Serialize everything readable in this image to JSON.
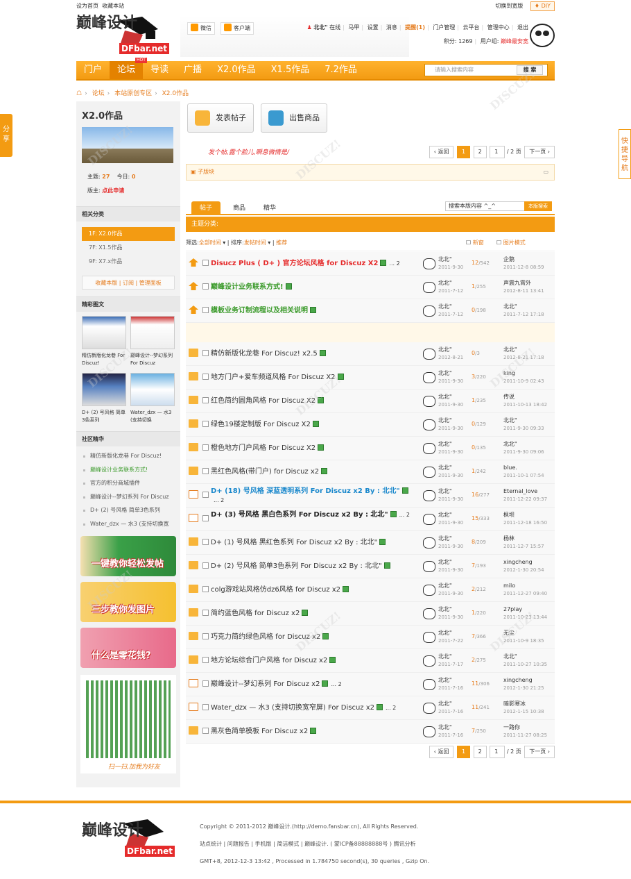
{
  "topbar": {
    "set_home": "设为首页",
    "favorite": "收藏本站",
    "switch_width": "切换到宽版",
    "diy": "♦ DIY"
  },
  "header": {
    "logo_text": "巅峰设计",
    "logo_badge": "DFbar.net",
    "weixin": "微信",
    "client": "客户端",
    "user": "北北\"",
    "online": "在线",
    "menu": [
      "马甲",
      "设置",
      "消息",
      "提醒(1)",
      "门户管理",
      "云平台",
      "管理中心",
      "退出"
    ],
    "points": "积分: 1269",
    "group": "用户组:",
    "group_name": "巅峰最安宽"
  },
  "nav": {
    "items": [
      "门户",
      "论坛",
      "导读",
      "广播",
      "X2.0作品",
      "X1.5作品",
      "7.2作品"
    ],
    "hot": "HOT",
    "search_placeholder": "请输入搜索内容",
    "search_btn": "搜 索"
  },
  "crumb": [
    "论坛",
    "本站原创专区",
    "X2.0作品"
  ],
  "side": {
    "forum_title": "X2.0作品",
    "topics_label": "主题:",
    "topics": "27",
    "today_label": "今日:",
    "today": "0",
    "mod_label": "版主:",
    "mod": "点此申请",
    "related_h": "相关分类",
    "cats": [
      "1F: X2.0作品",
      "7F: X1.5作品",
      "9F: X7.x作品"
    ],
    "links": "收藏本版 | 订阅 | 管理面板",
    "photos_h": "精彩图文",
    "thumbs": [
      "精仿新版化龙巷 For Discuz!",
      "巅峰设计--梦幻系列 For Discuz",
      "D+ (2) 号风格 简单3色系列",
      "Water_dzx — 水3 (支持切换"
    ],
    "community_h": "社区精华",
    "community": [
      "精仿新版化龙巷 For Discuz!",
      "巅峰设计业务联系方式!",
      "官方的积分商城插件",
      "巅峰设计--梦幻系列 For Discuz",
      "D+ (2) 号风格 简单3色系列",
      "Water_dzx — 水3 (支持切换宽"
    ],
    "banners": [
      "一键教你轻松发帖",
      "三步教你发图片",
      "什么是零花钱?"
    ],
    "qr_caption": "扫一扫,加我为好友"
  },
  "main": {
    "post_btn": "发表帖子",
    "sell_btn": "出售商品",
    "slogan": "发个帖,露个脸儿,瞬息微情是/",
    "pager": {
      "back": "返回",
      "pages": [
        "1",
        "2"
      ],
      "jump": "1",
      "total": "/ 2 页",
      "next": "下一页"
    },
    "subforum": "子版块",
    "tabs": [
      "帖子",
      "商品",
      "精华"
    ],
    "tab_search": "搜索本版内容 ^_^",
    "tab_search_btn": "本版搜索",
    "type_bar": "主题分类:",
    "filter": {
      "label": "筛选:",
      "time": "全部时间",
      "sort_label": "排序:",
      "sort": "发帖时间",
      "rec": "推荐",
      "new": "新窗",
      "pic": "图片模式"
    },
    "threads": [
      {
        "title": "Disucz Plus ( D+ ) 官方论坛风格 for Discuz X2",
        "style": "red",
        "icon": "up",
        "extra": "... 2",
        "author": "北北\"",
        "date": "2011-9-30",
        "replies": "12",
        "views": "542",
        "last": "企鹅",
        "last_date": "2011-12-8 08:59"
      },
      {
        "title": "巅峰设计业务联系方式!",
        "style": "green",
        "icon": "up",
        "extra": "",
        "author": "北北\"",
        "date": "2011-7-12",
        "replies": "1",
        "views": "255",
        "last": "声震九霄外",
        "last_date": "2012-8-11 13:41"
      },
      {
        "title": "模板业务订制流程以及相关说明",
        "style": "green",
        "icon": "up",
        "extra": "",
        "author": "北北\"",
        "date": "2011-7-12",
        "replies": "0",
        "views": "198",
        "last": "北北\"",
        "last_date": "2011-7-12 17:18"
      },
      {
        "title": "精仿新版化龙巷 For Discuz! x2.5",
        "style": "",
        "icon": "folder",
        "extra": "",
        "author": "北北\"",
        "date": "2012-8-21",
        "replies": "0",
        "views": "3",
        "last": "北北\"",
        "last_date": "2012-8-21 17:18"
      },
      {
        "title": "地方门户+爱车频道风格 For Discuz X2",
        "style": "",
        "icon": "folder",
        "extra": "",
        "author": "北北\"",
        "date": "2011-9-30",
        "replies": "3",
        "views": "220",
        "last": "king",
        "last_date": "2011-10-9 02:43"
      },
      {
        "title": "红色简约圆角风格 For Discuz X2",
        "style": "",
        "icon": "folder",
        "extra": "",
        "author": "北北\"",
        "date": "2011-9-30",
        "replies": "1",
        "views": "235",
        "last": "传说",
        "last_date": "2011-10-13 18:42"
      },
      {
        "title": "绿色19楼定制版 For Discuz X2",
        "style": "",
        "icon": "folder",
        "extra": "",
        "author": "北北\"",
        "date": "2011-9-30",
        "replies": "0",
        "views": "129",
        "last": "北北\"",
        "last_date": "2011-9-30 09:33"
      },
      {
        "title": "橙色地方门户风格 For Discuz X2",
        "style": "",
        "icon": "folder",
        "extra": "",
        "author": "北北\"",
        "date": "2011-9-30",
        "replies": "0",
        "views": "135",
        "last": "北北\"",
        "last_date": "2011-9-30 09:06"
      },
      {
        "title": "黑红色风格(带门户) for Discuz x2",
        "style": "",
        "icon": "folder",
        "extra": "",
        "author": "北北\"",
        "date": "2011-9-30",
        "replies": "1",
        "views": "242",
        "last": "blue.",
        "last_date": "2011-10-1 07:54"
      },
      {
        "title": "D+ (18) 号风格 深蓝透明系列 For Discuz x2 By : 北北\"",
        "style": "blue",
        "icon": "doc",
        "extra": "... 2",
        "author": "北北\"",
        "date": "2011-9-30",
        "replies": "16",
        "views": "277",
        "last": "Eternal_love",
        "last_date": "2011-12-22 09:37"
      },
      {
        "title": "D+ (3) 号风格 黑白色系列 For Discuz x2 By : 北北\"",
        "style": "black",
        "icon": "doc",
        "extra": "... 2",
        "author": "北北\"",
        "date": "2011-9-30",
        "replies": "15",
        "views": "333",
        "last": "枫坝",
        "last_date": "2011-12-18 16:50"
      },
      {
        "title": "D+ (1) 号风格 黑红色系列 For Discuz x2 By : 北北\"",
        "style": "",
        "icon": "folder",
        "extra": "",
        "author": "北北\"",
        "date": "2011-9-30",
        "replies": "8",
        "views": "209",
        "last": "杨林",
        "last_date": "2011-12-7 15:57"
      },
      {
        "title": "D+ (2) 号风格 简单3色系列 For Discuz x2 By : 北北\"",
        "style": "",
        "icon": "folder",
        "extra": "",
        "author": "北北\"",
        "date": "2011-9-30",
        "replies": "7",
        "views": "193",
        "last": "xingcheng",
        "last_date": "2012-1-30 20:54"
      },
      {
        "title": "colg游戏站风格仿dz6风格 for Discuz x2",
        "style": "",
        "icon": "folder",
        "extra": "",
        "author": "北北\"",
        "date": "2011-9-30",
        "replies": "2",
        "views": "212",
        "last": "milo",
        "last_date": "2011-12-27 09:40"
      },
      {
        "title": "简约蓝色风格 for Discuz x2",
        "style": "",
        "icon": "folder",
        "extra": "",
        "author": "北北\"",
        "date": "2011-9-30",
        "replies": "1",
        "views": "220",
        "last": "27play",
        "last_date": "2011-10-23 13:44"
      },
      {
        "title": "巧克力简约绿色风格 for Discuz x2",
        "style": "",
        "icon": "folder",
        "extra": "",
        "author": "北北\"",
        "date": "2011-7-22",
        "replies": "7",
        "views": "366",
        "last": "无尘",
        "last_date": "2011-10-9 18:35"
      },
      {
        "title": "地方论坛综合门户风格 for Discuz x2",
        "style": "",
        "icon": "folder",
        "extra": "",
        "author": "北北\"",
        "date": "2011-7-17",
        "replies": "2",
        "views": "275",
        "last": "北北\"",
        "last_date": "2011-10-27 10:35"
      },
      {
        "title": "巅峰设计--梦幻系列 For Discuz x2",
        "style": "",
        "icon": "doc",
        "extra": "... 2",
        "author": "北北\"",
        "date": "2011-7-16",
        "replies": "11",
        "views": "306",
        "last": "xingcheng",
        "last_date": "2012-1-30 21:25"
      },
      {
        "title": "Water_dzx — 水3 (支持切换宽窄屏) For Discuz x2",
        "style": "",
        "icon": "doc",
        "extra": "... 2",
        "author": "北北\"",
        "date": "2011-7-16",
        "replies": "11",
        "views": "241",
        "last": "暗影寒冰",
        "last_date": "2012-1-15 10:38"
      },
      {
        "title": "黑灰色简单模板 For Discuz x2",
        "style": "",
        "icon": "folder",
        "extra": "",
        "author": "北北\"",
        "date": "2011-7-16",
        "replies": "7",
        "views": "250",
        "last": "一路你",
        "last_date": "2011-11-27 08:25"
      }
    ]
  },
  "footer": {
    "copyright": "Copyright © 2011-2012 巅峰设计.(http://demo.fansbar.cn), All Rights Reserved.",
    "links": "站点统计 | 问题报告 | 手机版 | 简洁模式 | 巅峰设计. ( 蒙ICP备88888888号 ) 腾讯分析",
    "meta": "GMT+8, 2012-12-3 13:42 , Processed in 1.784750 second(s), 30 queries , Gzip On."
  },
  "float": {
    "share": "分享",
    "quick": "快捷导航"
  },
  "colors": {
    "accent": "#f39b12",
    "link_orange": "#e57c1e",
    "red": "#e52b2b",
    "green": "#3a9a2a",
    "blue": "#1a88cc"
  }
}
